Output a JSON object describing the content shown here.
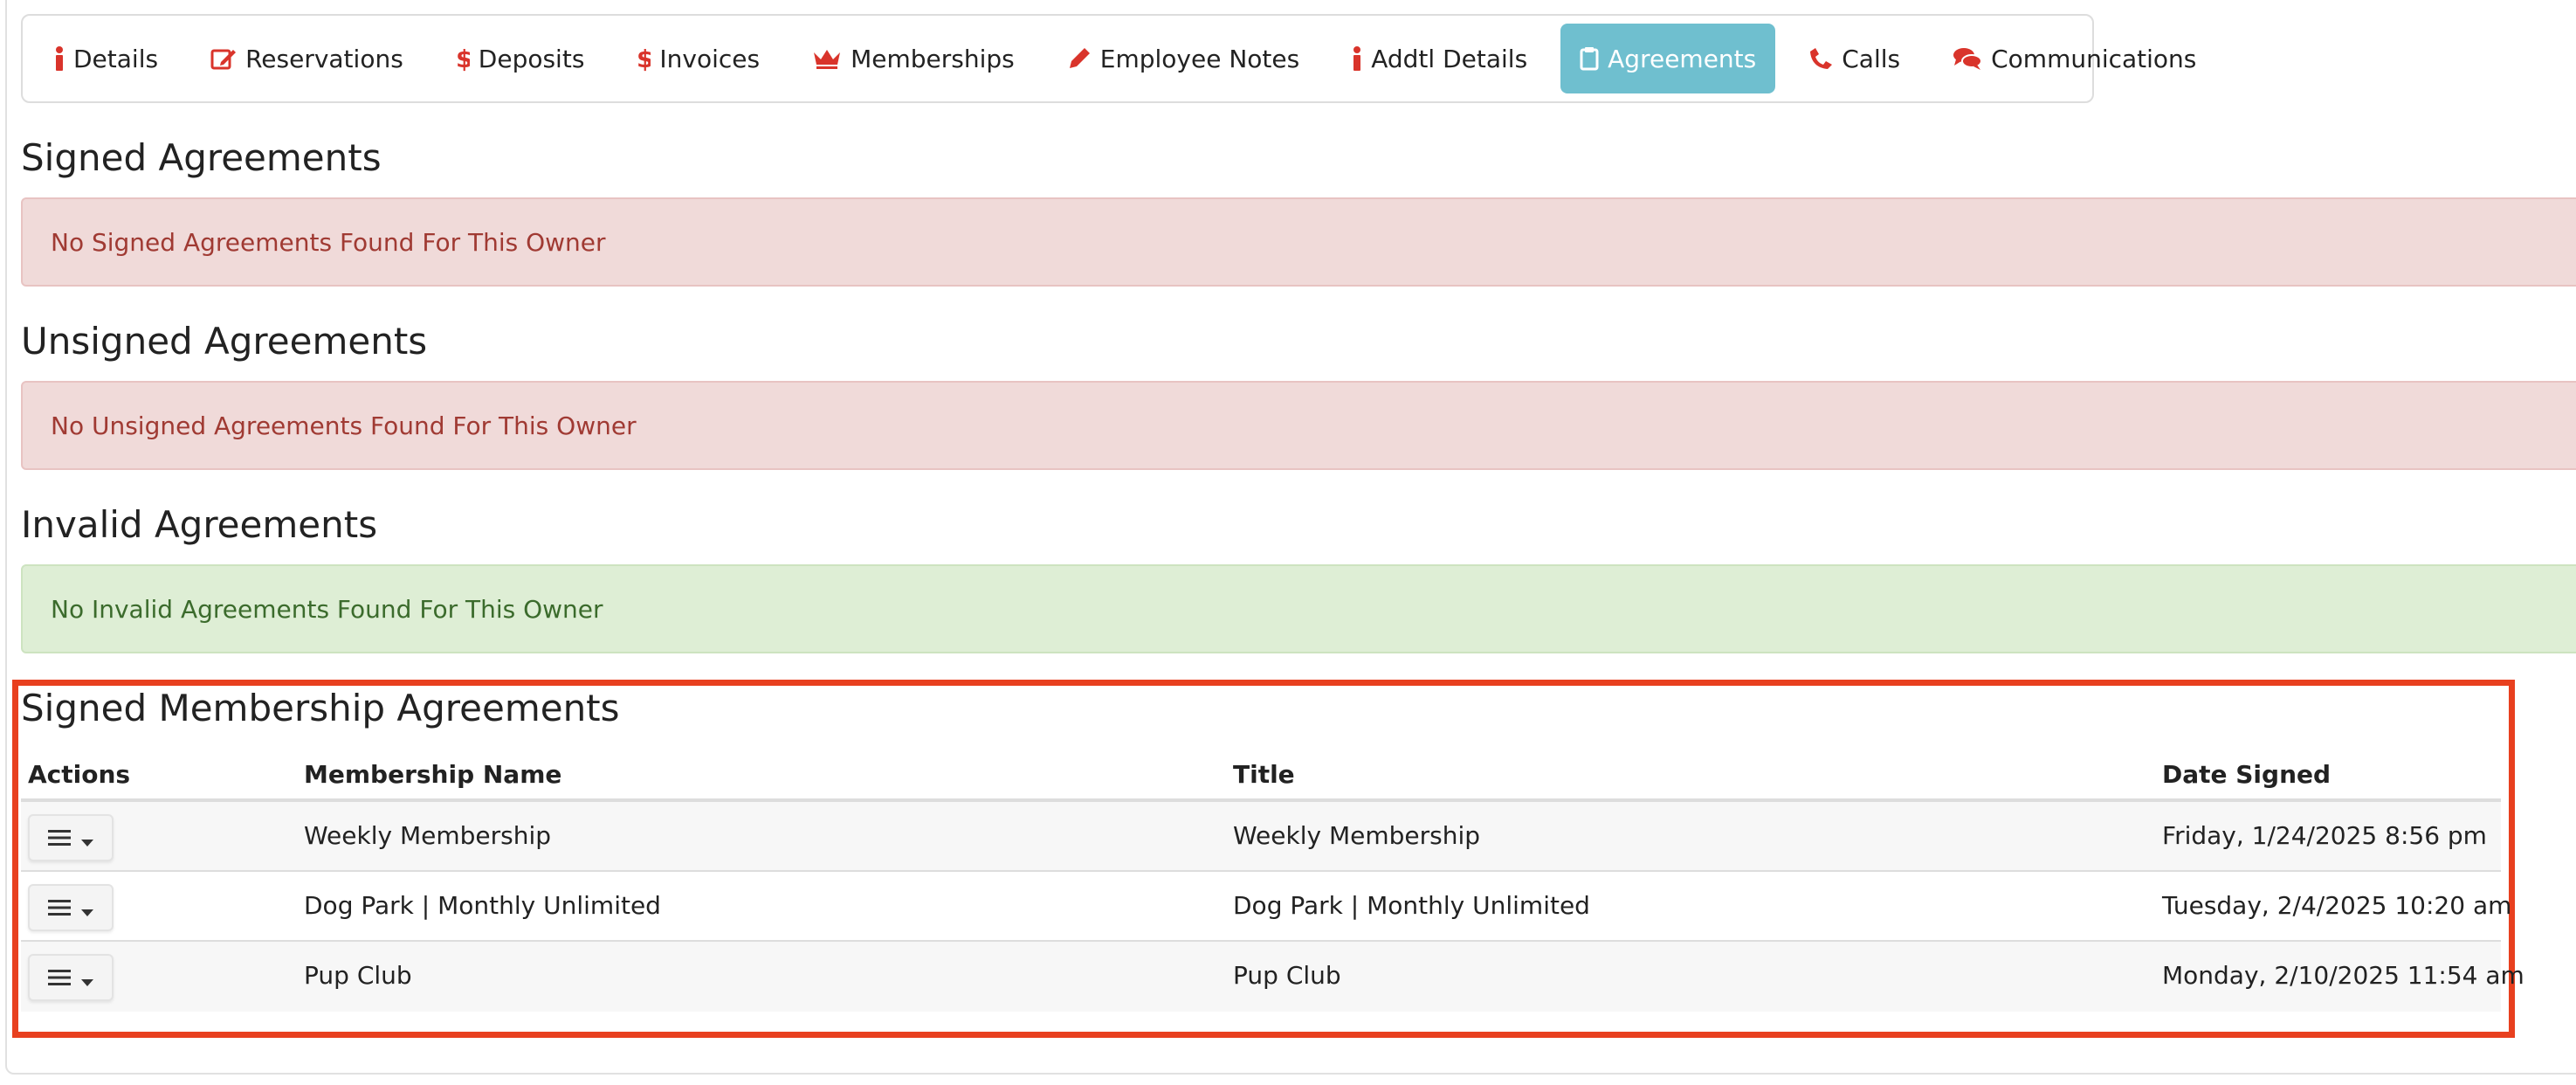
{
  "tabs": [
    {
      "label": "Details",
      "icon": "info-icon"
    },
    {
      "label": "Reservations",
      "icon": "edit-icon"
    },
    {
      "label": "Deposits",
      "icon": "dollar-icon"
    },
    {
      "label": "Invoices",
      "icon": "dollar-icon"
    },
    {
      "label": "Memberships",
      "icon": "crown-icon"
    },
    {
      "label": "Employee Notes",
      "icon": "pencil-icon"
    },
    {
      "label": "Addtl Details",
      "icon": "info-icon"
    },
    {
      "label": "Agreements",
      "icon": "clipboard-icon",
      "active": true
    },
    {
      "label": "Calls",
      "icon": "phone-icon"
    },
    {
      "label": "Communications",
      "icon": "comments-icon"
    }
  ],
  "sections": {
    "signed": {
      "heading": "Signed Agreements",
      "message": "No Signed Agreements Found For This Owner"
    },
    "unsigned": {
      "heading": "Unsigned Agreements",
      "message": "No Unsigned Agreements Found For This Owner"
    },
    "invalid": {
      "heading": "Invalid Agreements",
      "message": "No Invalid Agreements Found For This Owner"
    }
  },
  "membership": {
    "heading": "Signed Membership Agreements",
    "columns": [
      "Actions",
      "Membership Name",
      "Title",
      "Date Signed"
    ],
    "rows": [
      {
        "name": "Weekly Membership",
        "title": "Weekly Membership",
        "date": "Friday, 1/24/2025 8:56 pm"
      },
      {
        "name": "Dog Park | Monthly Unlimited",
        "title": "Dog Park | Monthly Unlimited",
        "date": "Tuesday, 2/4/2025 10:20 am"
      },
      {
        "name": "Pup Club",
        "title": "Pup Club",
        "date": "Monday, 2/10/2025 11:54 am"
      }
    ]
  },
  "colors": {
    "icon_red": "#d9342b",
    "active_tab": "#6fbfcf",
    "danger_bg": "#f0dad9",
    "success_bg": "#deeed5",
    "highlight": "#e8401f"
  }
}
